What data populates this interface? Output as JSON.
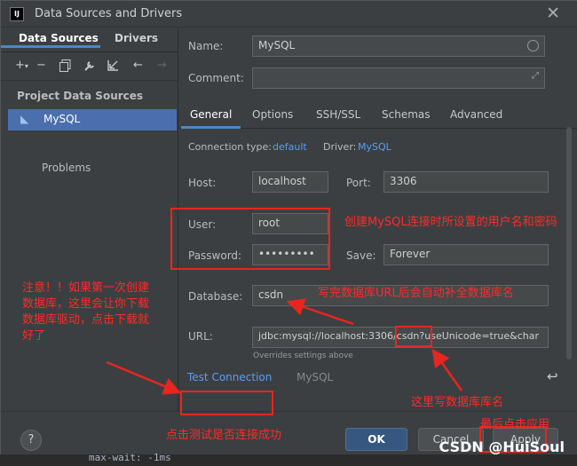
{
  "window": {
    "title": "Data Sources and Drivers",
    "app_icon_text": "IJ",
    "close_glyph": "✕"
  },
  "left_panel": {
    "tabs": [
      "Data Sources",
      "Drivers"
    ],
    "section_header": "Project Data Sources",
    "data_source": "MySQL",
    "problems_label": "Problems"
  },
  "form": {
    "name_label": "Name:",
    "name_value": "MySQL",
    "comment_label": "Comment:",
    "comment_value": "",
    "tabs": [
      "General",
      "Options",
      "SSH/SSL",
      "Schemas",
      "Advanced"
    ],
    "active_tab": "General",
    "connection_type_label": "Connection type:",
    "connection_type_value": "default",
    "driver_label": "Driver:",
    "driver_value": "MySQL",
    "host_label": "Host:",
    "host_value": "localhost",
    "port_label": "Port:",
    "port_value": "3306",
    "user_label": "User:",
    "user_value": "root",
    "password_label": "Password:",
    "password_value": "•••••••••",
    "save_label": "Save:",
    "save_value": "Forever",
    "database_label": "Database:",
    "database_value": "csdn",
    "url_label": "URL:",
    "url_value": "jdbc:mysql://localhost:3306/csdn?useUnicode=true&char",
    "url_note": "Overrides settings above"
  },
  "bottom": {
    "test_connection": "Test Connection",
    "driver_name": "MySQL",
    "revert_glyph": "↩"
  },
  "footer": {
    "help": "?",
    "ok": "OK",
    "cancel": "Cancel",
    "apply": "Apply"
  },
  "annotations": {
    "user_pwd": "创建MySQL连接时所设置的用户名和密码",
    "database": "写完数据库URL后会自动补全数据库名",
    "left_note": "注意！！如果第一次创建数据库，这里会让你下载数据库驱动，点击下载就好了",
    "db_name_here": "这里写数据库库名",
    "apply_last": "最后点击应用",
    "test_note": "点击测试是否连接成功"
  },
  "editor": {
    "code": "max-wait: -1ms"
  },
  "watermark": "CSDN @HuiSoul",
  "colors": {
    "accent": "#4a88c7",
    "selection": "#4b6eaf",
    "annotation": "#e8251f",
    "link": "#589df6"
  }
}
